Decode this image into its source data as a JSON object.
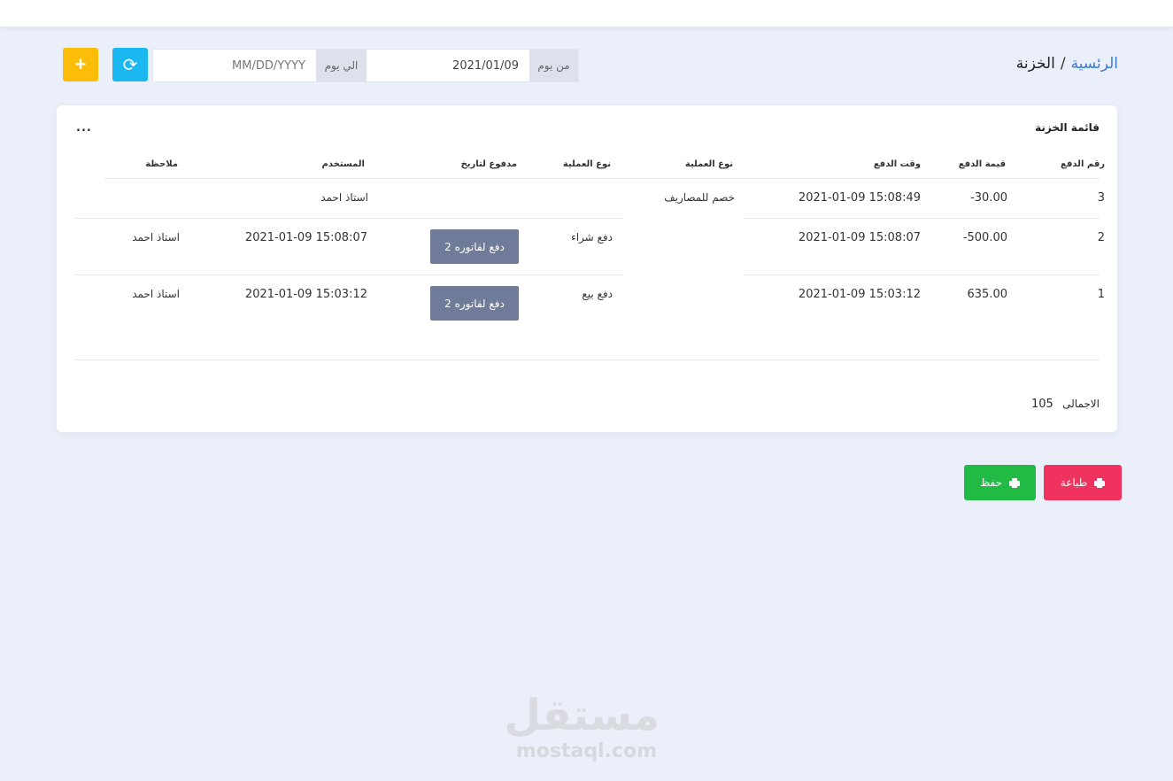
{
  "breadcrumb": {
    "home": "الرئسية",
    "separator": "/",
    "current": "الخزنة"
  },
  "filter": {
    "from_label": "من يوم",
    "from_value": "2021/01/09",
    "to_label": "الي يوم",
    "to_placeholder": "MM/DD/YYYY"
  },
  "buttons": {
    "add": "+",
    "refresh": "⟳"
  },
  "card": {
    "title": "قائمة الخزنة",
    "dots": "...",
    "columns": [
      "رقم الدفع",
      "قيمة الدفع",
      "وقت الدفع",
      "نوع العملية",
      "نوع العملية",
      "مدفوع لتاريخ",
      "المستخدم",
      "ملاحظة"
    ],
    "rows": [
      {
        "id": "3",
        "amount": "-30.00",
        "time": "2021-01-09 15:08:49",
        "type": "خصم للمصاريف",
        "subtype": "",
        "paid_for": "",
        "user": "استاذ احمد",
        "note": ""
      },
      {
        "id": "2",
        "amount": "-500.00",
        "time": "2021-01-09 15:08:07",
        "type": "",
        "subtype": "دفع شراء",
        "paid_for": "دفع لفاتوره 2",
        "user": "2021-01-09 15:08:07",
        "note": "استاذ احمد"
      },
      {
        "id": "1",
        "amount": "635.00",
        "time": "2021-01-09 15:03:12",
        "type": "",
        "subtype": "دفع بيع",
        "paid_for": "دفع لفاتوره 2",
        "user": "2021-01-09 15:03:12",
        "note": "استاذ احمد"
      }
    ],
    "total_label": "الاجمالى",
    "total_value": "105"
  },
  "actions": {
    "print": "طباعة",
    "save": "حفظ"
  },
  "watermark": {
    "ar": "مستقل",
    "en": "mostaql.com"
  }
}
